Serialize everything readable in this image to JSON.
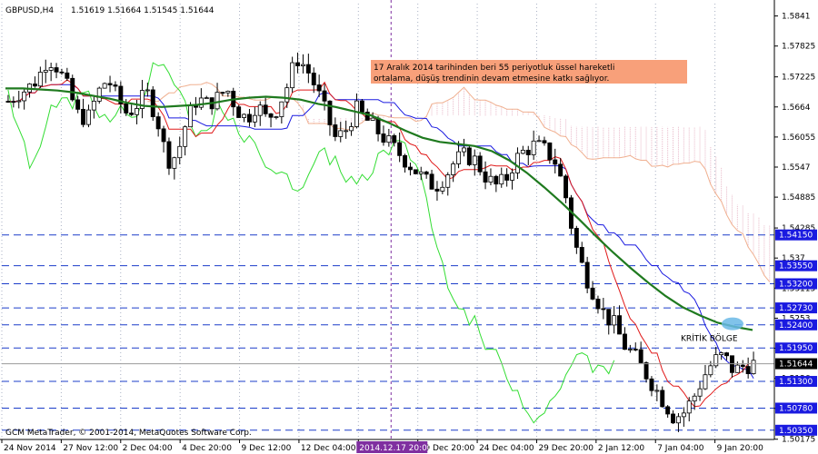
{
  "header": {
    "symbol": "GBPUSD,H4",
    "ohlc": "1.51619 1.51664 1.51545 1.51644"
  },
  "annotation": {
    "line1": "17 Aralık 2014 tarihinden beri 55 periyotluk üssel hareketli",
    "line2": "ortalama, düşüş trendinin devam etmesine katkı sağlıyor."
  },
  "critical_zone_label": "KRİTİK BÖLGE",
  "footer": "GCM MetaTrader, © 2001-2014, MetaQuotes Software Corp.",
  "colors": {
    "grid": "#a9b2c4",
    "level": "#1b3cc9",
    "candles": "#000000",
    "ema55": "#1f7a1f",
    "tenkan": "#e01a1a",
    "kijun": "#1a1ae0",
    "chikou": "#33dd33",
    "cloud": "#e8b8c8",
    "cloud_edge": "#f0b090",
    "vline": "#7f2fa0",
    "annotation_bg": "#f8a07a",
    "circle": "#6ab8e6",
    "badge": "#1a1ae0",
    "cursor_badge": "#7f2fa0"
  },
  "chart_data": {
    "type": "candlestick",
    "symbol": "GBPUSD",
    "timeframe": "H4",
    "ylim": [
      1.5017,
      1.5865
    ],
    "y_ticks": [
      1.5841,
      1.57825,
      1.57225,
      1.5664,
      1.56055,
      1.5547,
      1.54885,
      1.54285,
      1.537,
      1.53115,
      1.5253,
      1.51945,
      1.5136,
      1.50775,
      1.50175
    ],
    "x_ticks": [
      "24 Nov 2014",
      "27 Nov 12:00",
      "2 Dec 04:00",
      "4 Dec 20:00",
      "9 Dec 12:00",
      "12 Dec 04:00",
      "2014.12.17 20:00",
      "19 Dec 20:00",
      "24 Dec 04:00",
      "29 Dec 20:00",
      "2 Jan 12:00",
      "7 Jan 04:00",
      "9 Jan 20:00"
    ],
    "cursor_label": "2014.12.17 20:00",
    "support_resistance_levels": [
      1.5415,
      1.5355,
      1.532,
      1.5273,
      1.524,
      1.5195,
      1.513,
      1.5078,
      1.5035
    ],
    "current_price": 1.51644,
    "price_path": [
      1.5675,
      1.569,
      1.57,
      1.572,
      1.576,
      1.574,
      1.57,
      1.565,
      1.564,
      1.569,
      1.572,
      1.568,
      1.565,
      1.567,
      1.569,
      1.564,
      1.556,
      1.557,
      1.564,
      1.568,
      1.567,
      1.568,
      1.57,
      1.566,
      1.564,
      1.567,
      1.564,
      1.566,
      1.57,
      1.576,
      1.574,
      1.57,
      1.565,
      1.56,
      1.562,
      1.566,
      1.564,
      1.562,
      1.56,
      1.558,
      1.556,
      1.554,
      1.552,
      1.551,
      1.553,
      1.556,
      1.557,
      1.556,
      1.553,
      1.551,
      1.552,
      1.556,
      1.558,
      1.559,
      1.558,
      1.556,
      1.55,
      1.54,
      1.534,
      1.53,
      1.526,
      1.524,
      1.52,
      1.518,
      1.515,
      1.512,
      1.509,
      1.506,
      1.507,
      1.51,
      1.514,
      1.517,
      1.518,
      1.515,
      1.516,
      1.5164
    ],
    "ema55_path": [
      1.57,
      1.57,
      1.5698,
      1.5696,
      1.5692,
      1.5686,
      1.568,
      1.5672,
      1.5666,
      1.5664,
      1.5666,
      1.5668,
      1.5672,
      1.5678,
      1.5682,
      1.5684,
      1.5682,
      1.5678,
      1.567,
      1.5664,
      1.5656,
      1.5648,
      1.5634,
      1.5618,
      1.5604,
      1.5596,
      1.5592,
      1.5588,
      1.5578,
      1.556,
      1.5536,
      1.5508,
      1.5478,
      1.5446,
      1.5412,
      1.538,
      1.535,
      1.5322,
      1.5296,
      1.5274,
      1.5258,
      1.5244,
      1.5236,
      1.523
    ],
    "annotations": [
      "17 Aralık 2014 tarihinden beri 55 periyotluk üssel hareketli ortalama, düşüş trendinin devam etmesine katkı sağlıyor.",
      "KRİTİK BÖLGE"
    ]
  }
}
